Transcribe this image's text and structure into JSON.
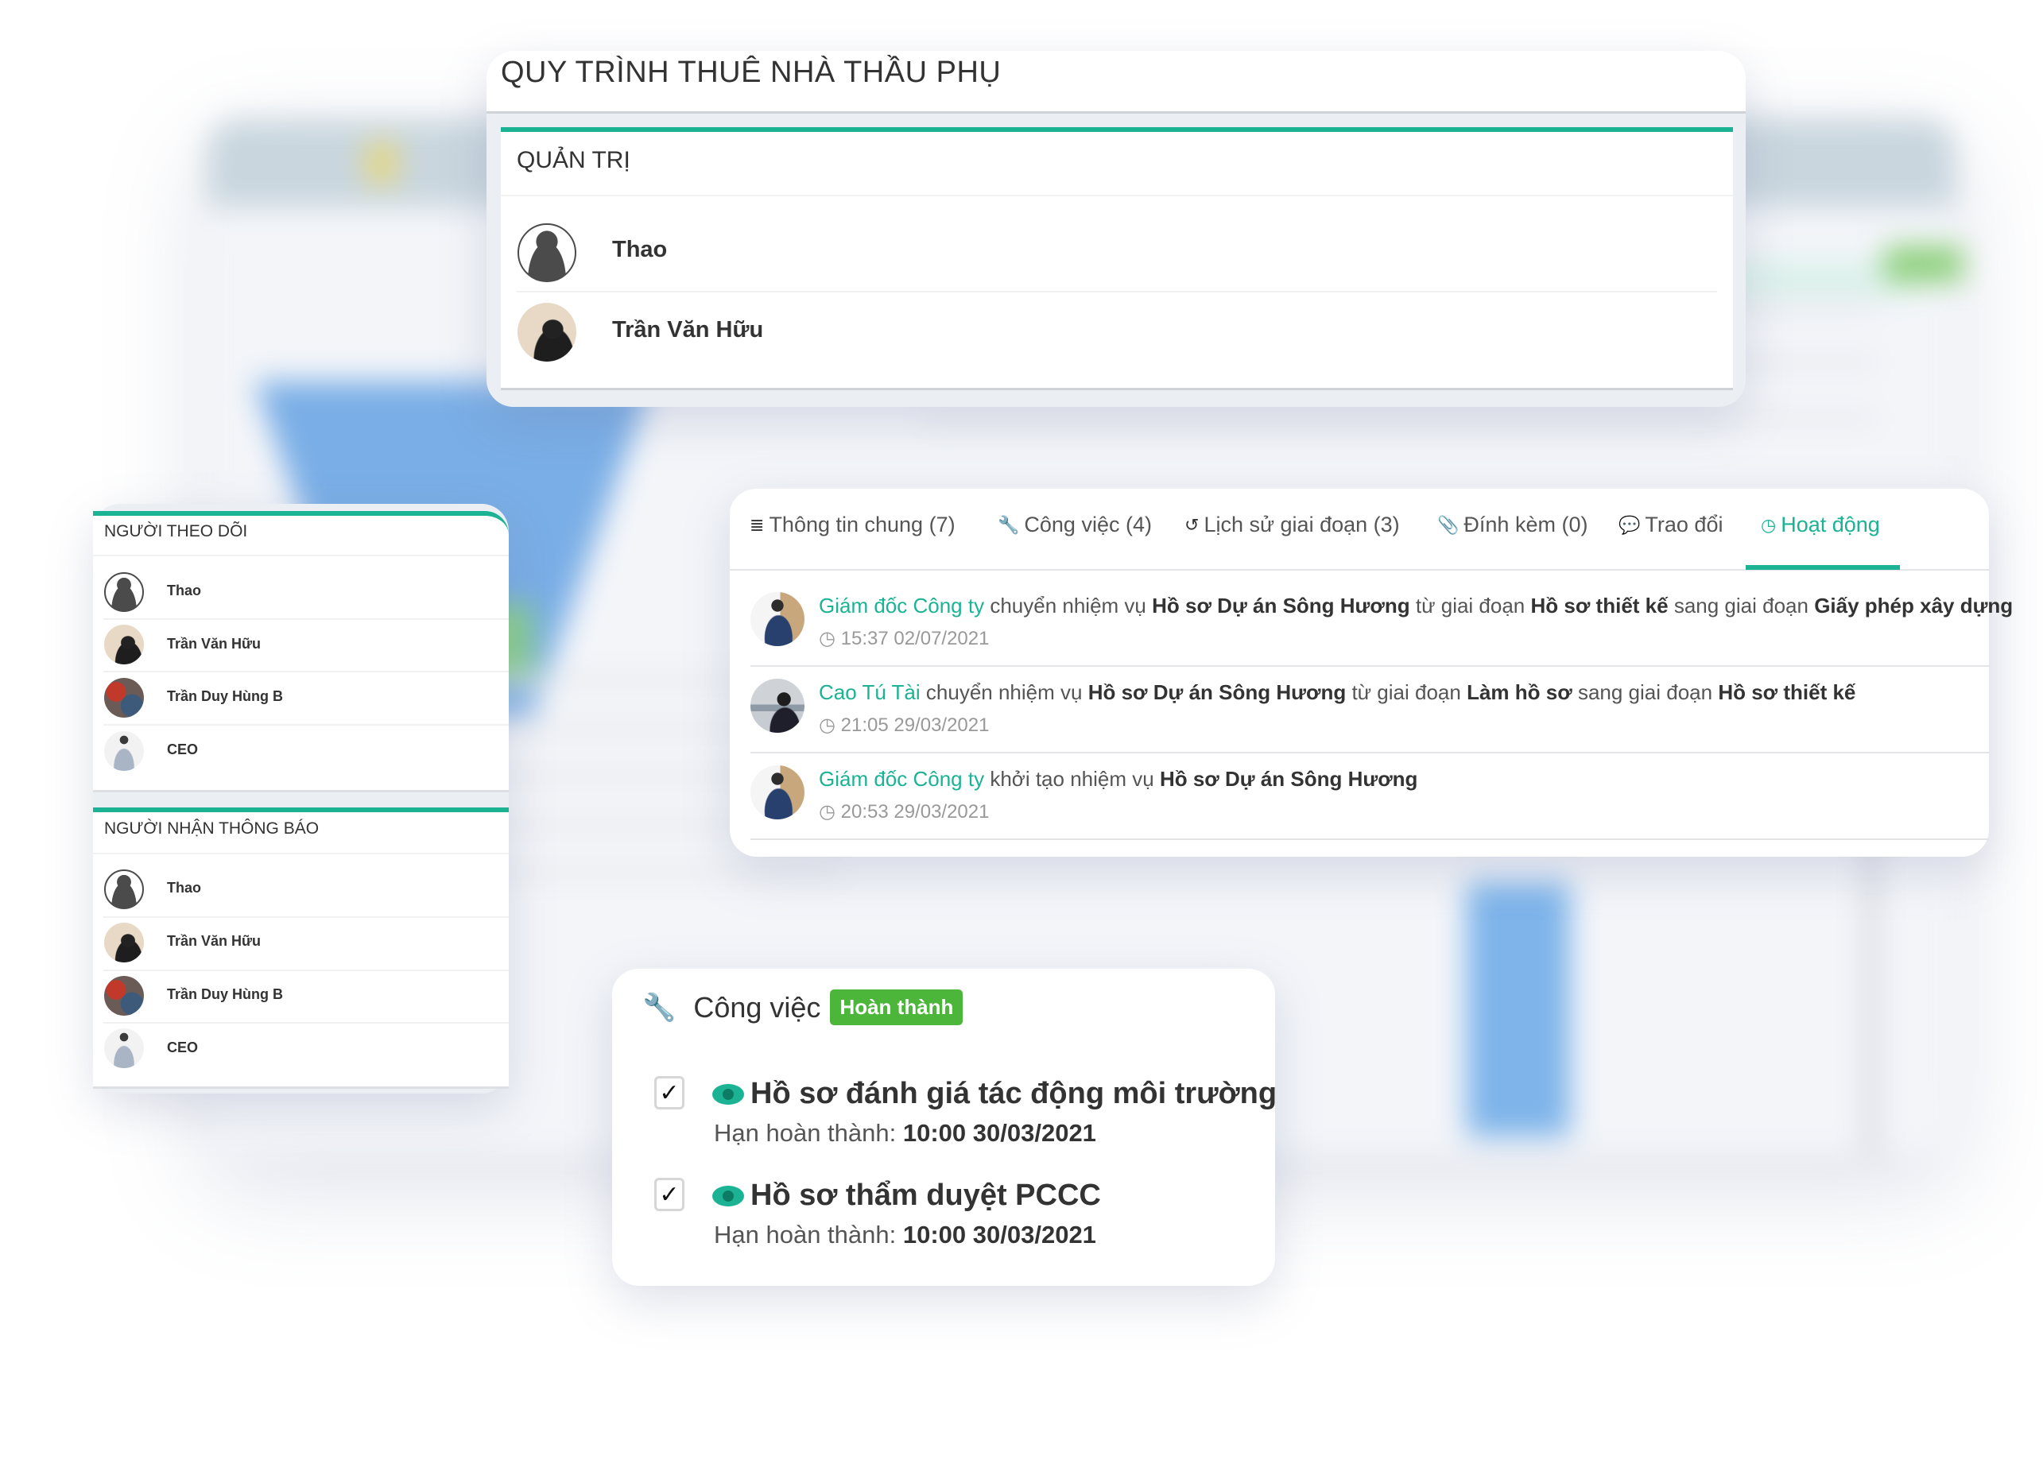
{
  "process": {
    "title": "QUY TRÌNH THUÊ NHÀ THẦU PHỤ",
    "admin_section": {
      "title": "QUẢN TRỊ",
      "members": [
        {
          "name": "Thao",
          "avatar": "silhouette-avatar"
        },
        {
          "name": "Trần Văn Hữu",
          "avatar": "photo-avatar"
        }
      ]
    }
  },
  "followers": {
    "title": "NGƯỜI THEO DÕI",
    "members": [
      {
        "name": "Thao"
      },
      {
        "name": "Trần Văn Hữu"
      },
      {
        "name": "Trần Duy Hùng B"
      },
      {
        "name": "CEO"
      }
    ]
  },
  "notified": {
    "title": "NGƯỜI NHẬN THÔNG BÁO",
    "members": [
      {
        "name": "Thao"
      },
      {
        "name": "Trần Văn Hữu"
      },
      {
        "name": "Trần Duy Hùng B"
      },
      {
        "name": "CEO"
      }
    ]
  },
  "activity_panel": {
    "tabs": [
      {
        "label": "Thông tin chung (7)",
        "icon": "list-icon",
        "glyph": "≣",
        "active": false
      },
      {
        "label": "Công việc (4)",
        "icon": "wrench-icon",
        "glyph": "🔧",
        "active": false
      },
      {
        "label": "Lịch sử giai đoạn (3)",
        "icon": "history-icon",
        "glyph": "↺",
        "active": false
      },
      {
        "label": "Đính kèm (0)",
        "icon": "paperclip-icon",
        "glyph": "📎",
        "active": false
      },
      {
        "label": "Trao đổi",
        "icon": "comments-icon",
        "glyph": "💬",
        "active": false
      },
      {
        "label": "Hoạt động",
        "icon": "clock-icon",
        "glyph": "◷",
        "active": true
      }
    ],
    "accent_color": "#1bb394",
    "entries": [
      {
        "actor": "Giám đốc Công ty",
        "verb": "chuyển nhiệm vụ",
        "task": "Hồ sơ Dự án Sông Hương",
        "from_label": "từ giai đoạn",
        "from_stage": "Hồ sơ thiết kế",
        "to_label": "sang giai đoạn",
        "to_stage": "Giấy phép xây dựng",
        "time": "15:37 02/07/2021"
      },
      {
        "actor": "Cao Tú Tài",
        "verb": "chuyển nhiệm vụ",
        "task": "Hồ sơ Dự án Sông Hương",
        "from_label": "từ giai đoạn",
        "from_stage": "Làm hồ sơ",
        "to_label": "sang giai đoạn",
        "to_stage": "Hồ sơ thiết kế",
        "time": "21:05 29/03/2021"
      },
      {
        "actor": "Giám đốc Công ty",
        "verb": "khởi tạo nhiệm vụ",
        "task": "Hồ sơ Dự án Sông Hương",
        "time": "20:53 29/03/2021"
      }
    ]
  },
  "task_card": {
    "title": "Công việc",
    "status_badge": "Hoàn thành",
    "status_color": "#4cb63a",
    "items": [
      {
        "title": "Hồ sơ đánh giá tác động môi trường",
        "checked": true,
        "deadline_label": "Hạn hoàn thành:",
        "deadline": "10:00 30/03/2021"
      },
      {
        "title": "Hồ sơ thẩm duyệt PCCC",
        "checked": true,
        "deadline_label": "Hạn hoàn thành:",
        "deadline": "10:00 30/03/2021"
      }
    ],
    "check_glyph": "✓"
  }
}
